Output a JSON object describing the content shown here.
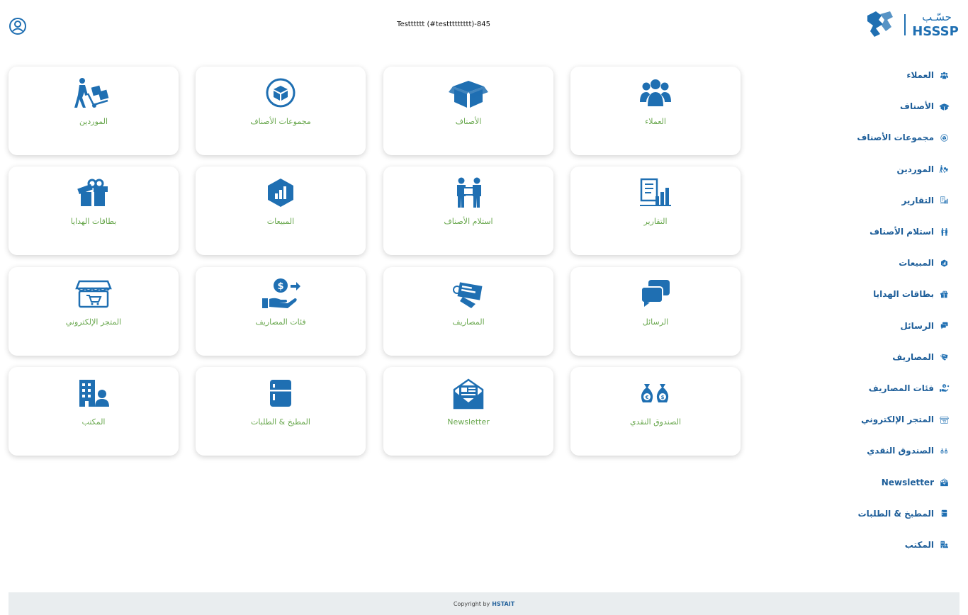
{
  "header": {
    "store_title": "Testttttt (#testtttttttt)-845",
    "logo_arabic": "حسّـب",
    "logo_latin": "HSSSP"
  },
  "colors": {
    "primary": "#1f6fb2",
    "label_green": "#6aa84f",
    "footer_bg": "#e9edef"
  },
  "sidebar": {
    "items": [
      {
        "label": "العملاء",
        "icon": "users-icon"
      },
      {
        "label": "الأصناف",
        "icon": "box-open-icon"
      },
      {
        "label": "مجموعات الأصناف",
        "icon": "circle-cube-icon"
      },
      {
        "label": "الموردين",
        "icon": "dolly-person-icon"
      },
      {
        "label": "التقارير",
        "icon": "reports-chart-icon"
      },
      {
        "label": "استلام الأصناف",
        "icon": "handover-people-icon"
      },
      {
        "label": "المبيعات",
        "icon": "hexagon-chart-icon"
      },
      {
        "label": "بطاقات الهدايا",
        "icon": "gift-icon"
      },
      {
        "label": "الرسائل",
        "icon": "chat-bubbles-icon"
      },
      {
        "label": "المصاريف",
        "icon": "money-check-icon"
      },
      {
        "label": "فئات المصاريف",
        "icon": "hand-dollar-icon"
      },
      {
        "label": "المتجر الإلكتروني",
        "icon": "store-icon"
      },
      {
        "label": "الصندوق النقدي",
        "icon": "money-bags-icon"
      },
      {
        "label": "Newsletter",
        "icon": "envelope-news-icon"
      },
      {
        "label": "المطبخ & الطلبات",
        "icon": "fridge-icon"
      },
      {
        "label": "المكتب",
        "icon": "office-user-icon"
      }
    ]
  },
  "cards": [
    {
      "label": "العملاء",
      "icon": "users-icon"
    },
    {
      "label": "الأصناف",
      "icon": "box-open-icon"
    },
    {
      "label": "مجموعات الأصناف",
      "icon": "circle-cube-icon"
    },
    {
      "label": "الموردين",
      "icon": "dolly-person-icon"
    },
    {
      "label": "التقارير",
      "icon": "reports-chart-icon"
    },
    {
      "label": "استلام الأصناف",
      "icon": "handover-people-icon"
    },
    {
      "label": "المبيعات",
      "icon": "hexagon-chart-icon"
    },
    {
      "label": "بطاقات الهدايا",
      "icon": "gift-icon"
    },
    {
      "label": "الرسائل",
      "icon": "chat-bubbles-icon"
    },
    {
      "label": "المصاريف",
      "icon": "money-check-icon"
    },
    {
      "label": "فئات المصاريف",
      "icon": "hand-dollar-icon"
    },
    {
      "label": "المتجر الإلكتروني",
      "icon": "store-icon"
    },
    {
      "label": "الصندوق النقدي",
      "icon": "money-bags-icon"
    },
    {
      "label": "Newsletter",
      "icon": "envelope-news-icon"
    },
    {
      "label": "المطبخ & الطلبات",
      "icon": "fridge-icon"
    },
    {
      "label": "المكتب",
      "icon": "office-user-icon"
    }
  ],
  "footer": {
    "copyright": "Copyright by",
    "brand": "HSTAIT"
  }
}
